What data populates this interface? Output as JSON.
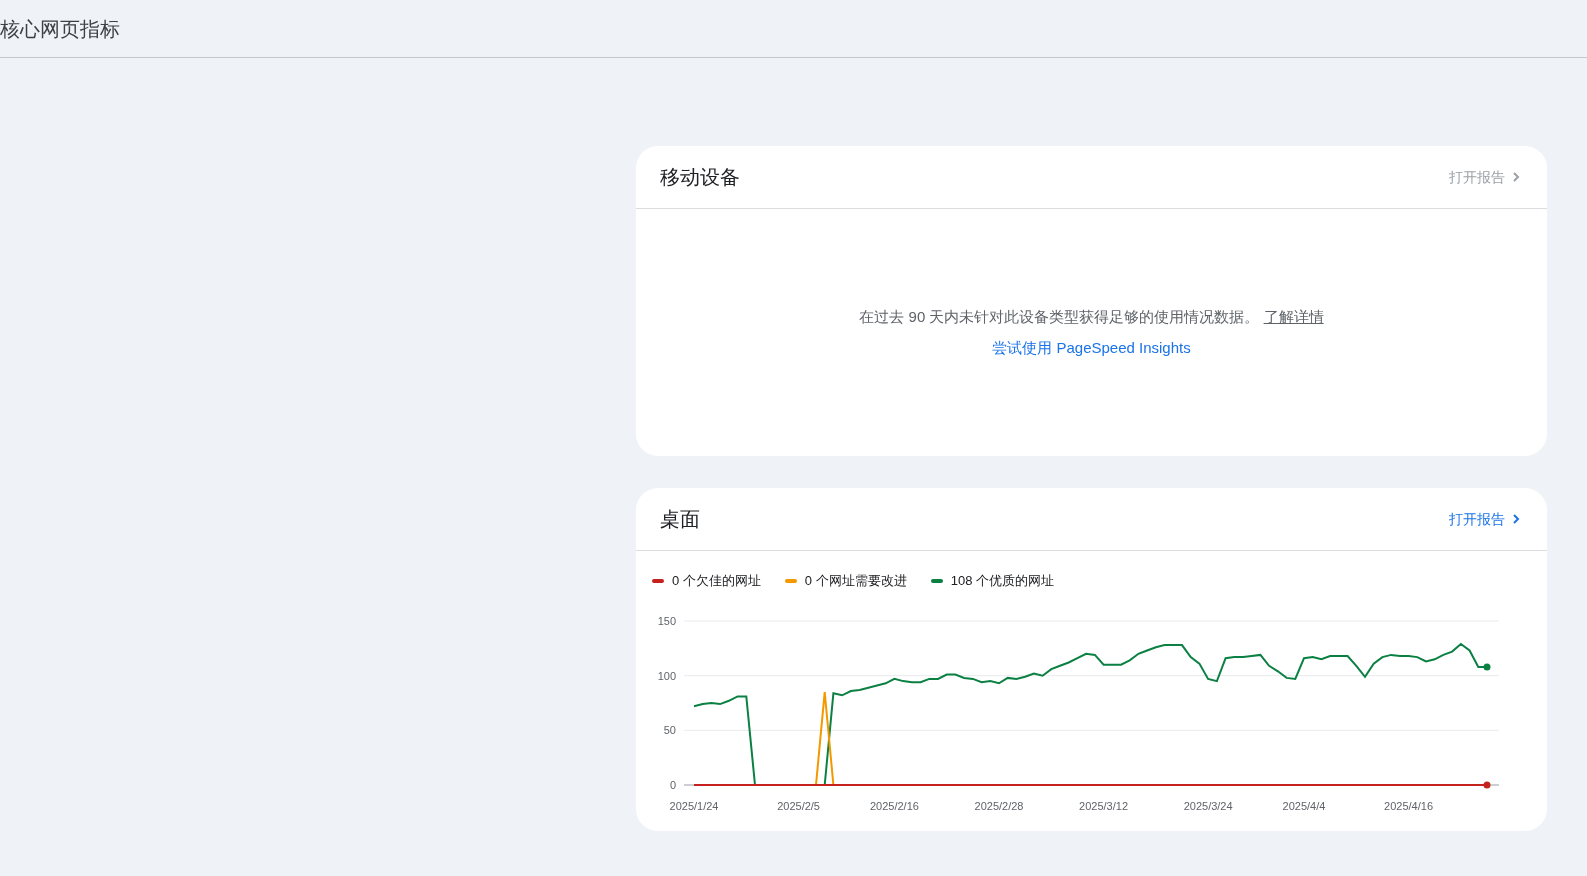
{
  "page_title": "核心网页指标",
  "cards": [
    {
      "title": "移动设备",
      "open_report": {
        "label": "打开报告",
        "disabled": true
      },
      "kind": "empty",
      "message": "在过去 90 天内未针对此设备类型获得足够的使用情况数据。",
      "learn_more": "了解详情",
      "try_link": "尝试使用 PageSpeed Insights"
    },
    {
      "title": "桌面",
      "open_report": {
        "label": "打开报告",
        "disabled": false
      },
      "kind": "chart",
      "chart_data": {
        "type": "line",
        "categories": [
          "2025/1/24",
          null,
          null,
          null,
          null,
          null,
          null,
          null,
          null,
          null,
          null,
          null,
          "2025/2/5",
          null,
          null,
          null,
          null,
          null,
          null,
          null,
          null,
          null,
          null,
          "2025/2/16",
          null,
          null,
          null,
          null,
          null,
          null,
          null,
          null,
          null,
          null,
          null,
          "2025/2/28",
          null,
          null,
          null,
          null,
          null,
          null,
          null,
          null,
          null,
          null,
          null,
          "2025/3/12",
          null,
          null,
          null,
          null,
          null,
          null,
          null,
          null,
          null,
          null,
          null,
          "2025/3/24",
          null,
          null,
          null,
          null,
          null,
          null,
          null,
          null,
          null,
          null,
          "2025/4/4",
          null,
          null,
          null,
          null,
          null,
          null,
          null,
          null,
          null,
          null,
          null,
          "2025/4/16",
          null,
          null,
          null,
          null,
          null,
          null,
          null,
          null,
          null
        ],
        "legend": "top",
        "ylim": [
          0,
          150
        ],
        "yticks": [
          {
            "value": 0,
            "label": "0"
          },
          {
            "value": 50,
            "label": "50"
          },
          {
            "value": 100,
            "label": "100"
          },
          {
            "value": 150,
            "label": "150"
          }
        ],
        "series": [
          {
            "name": "0 个欠佳的网址",
            "color": "#c5221f",
            "values": [
              0,
              0,
              0,
              0,
              0,
              0,
              0,
              0,
              0,
              0,
              0,
              0,
              0,
              0,
              0,
              0,
              0,
              0,
              0,
              0,
              0,
              0,
              0,
              0,
              0,
              0,
              0,
              0,
              0,
              0,
              0,
              0,
              0,
              0,
              0,
              0,
              0,
              0,
              0,
              0,
              0,
              0,
              0,
              0,
              0,
              0,
              0,
              0,
              0,
              0,
              0,
              0,
              0,
              0,
              0,
              0,
              0,
              0,
              0,
              0,
              0,
              0,
              0,
              0,
              0,
              0,
              0,
              0,
              0,
              0,
              0,
              0,
              0,
              0,
              0,
              0,
              0,
              0,
              0,
              0,
              0,
              0,
              0,
              0,
              0,
              0,
              0,
              0,
              0,
              0,
              0,
              0
            ]
          },
          {
            "name": "0 个网址需要改进",
            "color": "#f29900",
            "values": [
              null,
              null,
              null,
              null,
              null,
              null,
              null,
              null,
              null,
              null,
              null,
              null,
              null,
              null,
              0,
              85,
              0,
              null,
              null,
              null,
              null,
              null,
              null,
              null,
              null,
              null,
              null,
              null,
              null,
              null,
              null,
              null,
              null,
              null,
              null,
              null,
              null,
              null,
              null,
              null,
              null,
              null,
              null,
              null,
              null,
              null,
              null,
              null,
              null,
              null,
              null,
              null,
              null,
              null,
              null,
              null,
              null,
              null,
              null,
              null,
              null,
              null,
              null,
              null,
              null,
              null,
              null,
              null,
              null,
              null,
              null,
              null,
              null,
              null,
              null,
              null,
              null,
              null,
              null,
              null,
              null,
              null,
              null,
              null,
              null,
              null,
              null,
              null,
              null,
              null,
              null,
              null
            ]
          },
          {
            "name": "108 个优质的网址",
            "color": "#0b8043",
            "values": [
              72,
              74,
              75,
              74,
              77,
              81,
              81,
              0,
              null,
              null,
              null,
              null,
              null,
              null,
              null,
              0,
              84,
              82,
              86,
              87,
              89,
              91,
              93,
              97,
              95,
              94,
              94,
              97,
              97,
              101,
              101,
              98,
              97,
              94,
              95,
              93,
              98,
              97,
              99,
              102,
              100,
              106,
              109,
              112,
              116,
              120,
              119,
              110,
              110,
              110,
              114,
              120,
              123,
              126,
              128,
              128,
              128,
              117,
              111,
              97,
              95,
              116,
              117,
              117,
              118,
              119,
              109,
              104,
              98,
              97,
              116,
              117,
              115,
              118,
              118,
              118,
              109,
              99,
              111,
              117,
              119,
              118,
              118,
              117,
              113,
              115,
              119,
              122,
              129,
              123,
              108,
              108
            ]
          }
        ]
      }
    }
  ]
}
